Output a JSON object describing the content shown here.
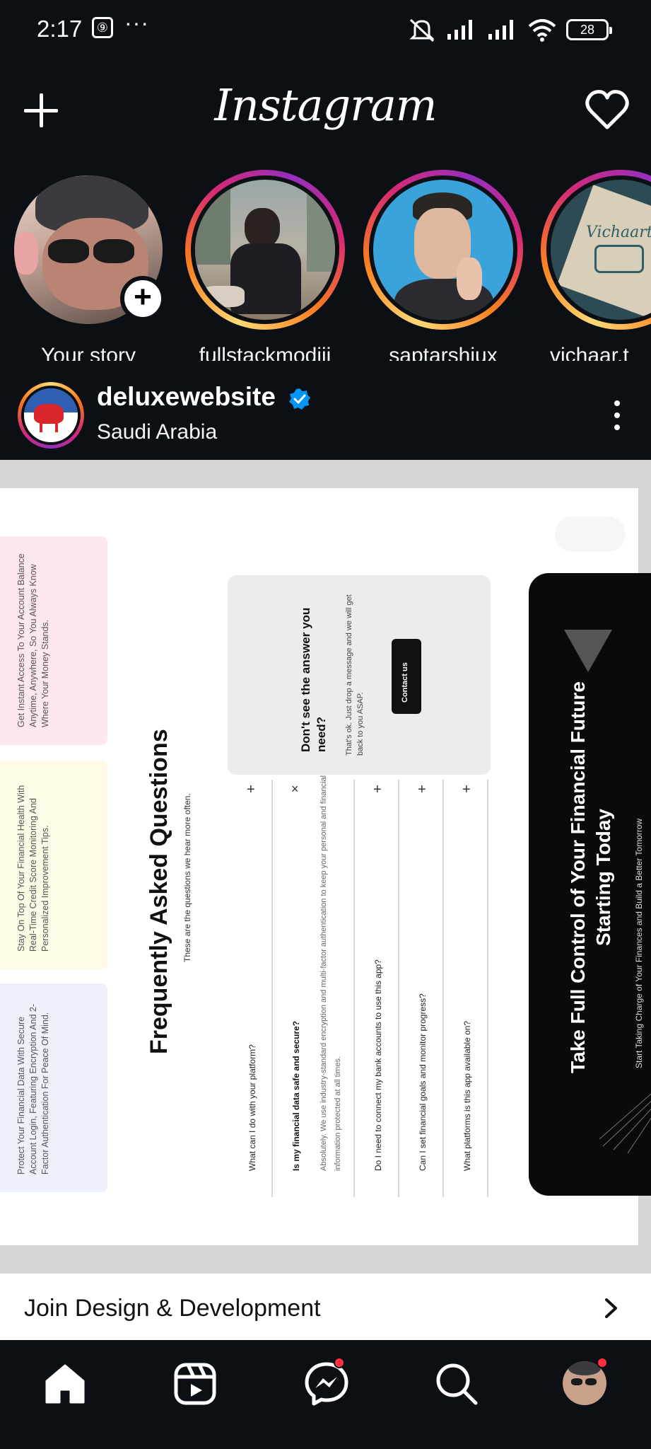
{
  "status_bar": {
    "time": "2:17",
    "sim_icon": "sim-card-icon",
    "dots": "···",
    "battery": "28"
  },
  "app": {
    "logo": "Instagram",
    "icons": {
      "add": "plus-icon",
      "notifications": "heart-icon"
    }
  },
  "stories": [
    {
      "label": "Your story",
      "own": true
    },
    {
      "label": "fullstackmodiji"
    },
    {
      "label": "saptarshiux"
    },
    {
      "label": "vichaar.t",
      "logo_text": "Vichaarti"
    }
  ],
  "post": {
    "username": "deluxewebsite",
    "verified": true,
    "location": "Saudi Arabia",
    "slide": {
      "features": [
        "Get Instant Access To Your Account Balance Anytime, Anywhere, So You Always Know Where Your Money Stands.",
        "Stay On Top Of Your Financial Health With Real-Time Credit Score Monitoring And Personalized Improvement Tips.",
        "Protect Your Financial Data With Secure Account Login, Featuring Encryption And 2-Factor Authentication For Peace Of Mind."
      ],
      "faq_title": "Frequently Asked Questions",
      "faq_subtitle": "These are the questions we hear more often.",
      "contact_heading": "Don't see the answer you need?",
      "contact_text": "That's ok. Just drop a message and we will get back to you ASAP.",
      "contact_button": "Contact us",
      "faq_items": [
        {
          "q": "What can I do with your platform?",
          "expanded": false
        },
        {
          "q": "Is my financial data safe and secure?",
          "expanded": true,
          "a": "Absolutely. We use industry-standard encryption and multi-factor authentication to keep your personal and financial information protected at all times."
        },
        {
          "q": "Do I need to connect my bank accounts to use this app?",
          "expanded": false
        },
        {
          "q": "Can I set financial goals and monitor progress?",
          "expanded": false
        },
        {
          "q": "What platforms is this app available on?",
          "expanded": false
        }
      ],
      "cta_title": "Take Full Control of Your Financial Future Starting Today",
      "cta_sub": "Start Taking Charge of Your Finances and Build a Better Tomorrow"
    }
  },
  "join_bar": {
    "label": "Join Design & Development"
  },
  "bottom_nav": {
    "items": [
      "home-icon",
      "reels-icon",
      "messenger-icon",
      "search-icon",
      "profile-avatar"
    ],
    "badge_color": "#ff3040"
  },
  "colors": {
    "background": "#0c1014",
    "text": "#f5f5f5",
    "verified": "#0095f6",
    "badge": "#ff3040"
  }
}
